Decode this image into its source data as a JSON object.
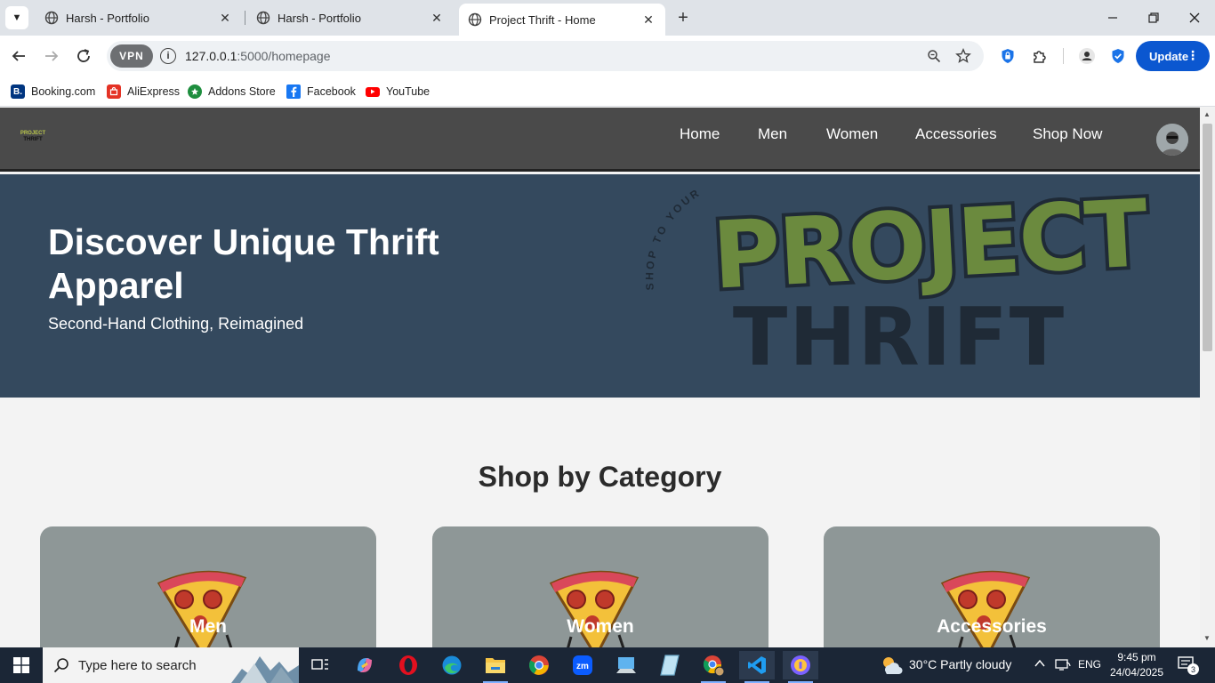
{
  "browser": {
    "tabs": [
      {
        "title": "Harsh - Portfolio",
        "active": false
      },
      {
        "title": "Harsh - Portfolio",
        "active": false
      },
      {
        "title": "Project Thrift - Home",
        "active": true
      }
    ],
    "vpn_label": "VPN",
    "url_host": "127.0.0.1",
    "url_path": ":5000/homepage",
    "update_label": "Update",
    "bookmarks": [
      "Booking.com",
      "AliExpress",
      "Addons Store",
      "Facebook",
      "YouTube"
    ],
    "bookmark_badges": {
      "booking": "B."
    }
  },
  "site": {
    "logo_line1": "PROJECT",
    "logo_line2": "THRIFT",
    "nav": [
      "Home",
      "Men",
      "Women",
      "Accessories",
      "Shop Now"
    ],
    "hero": {
      "title": "Discover Unique Thrift Apparel",
      "subtitle": "Second-Hand Clothing, Reimagined",
      "logo_word1": "PROJECT",
      "logo_word2": "THRIFT",
      "logo_arc": "SHOP TO YOUR"
    },
    "section_title": "Shop by Category",
    "categories": [
      "Men",
      "Women",
      "Accessories"
    ]
  },
  "taskbar": {
    "search_placeholder": "Type here to search",
    "weather": "30°C  Partly cloudy",
    "language": "ENG",
    "time": "9:45 pm",
    "date": "24/04/2025",
    "notification_count": "3"
  },
  "colors": {
    "nav_bg": "#4a4a4a",
    "hero_bg": "#34495e",
    "logo_green": "#6b8a3e",
    "logo_dark": "#1f2a36",
    "card_bg": "#8e9797",
    "update_blue": "#0b57d0"
  }
}
